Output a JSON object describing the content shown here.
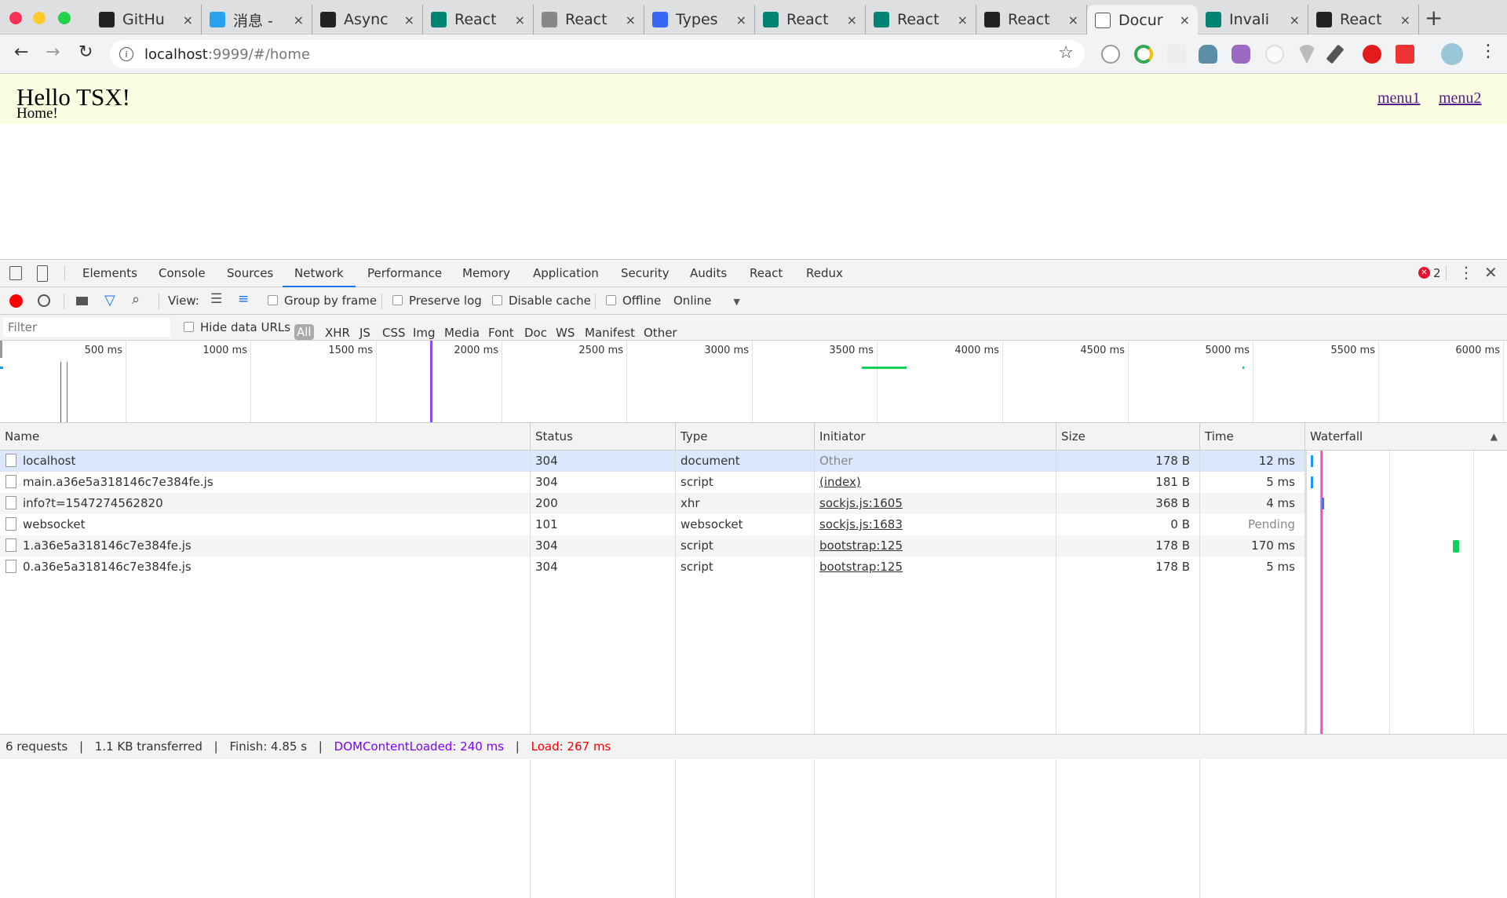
{
  "browser": {
    "tabs": [
      {
        "title": "GitHu",
        "icon": "github-icon",
        "color": "#222"
      },
      {
        "title": "消息 -",
        "icon": "cloud-icon",
        "color": "#2aa2f0"
      },
      {
        "title": "Async",
        "icon": "circle-x-icon",
        "color": "#222"
      },
      {
        "title": "React",
        "icon": "bing-icon",
        "color": "#008373"
      },
      {
        "title": "React",
        "icon": "hand-icon",
        "color": "#888"
      },
      {
        "title": "Types",
        "icon": "chevrons-icon",
        "color": "#3867f5"
      },
      {
        "title": "React",
        "icon": "bing-icon",
        "color": "#008373"
      },
      {
        "title": "React",
        "icon": "bing-icon",
        "color": "#008373"
      },
      {
        "title": "React",
        "icon": "react-icon",
        "color": "#222"
      },
      {
        "title": "Docur",
        "icon": "document-icon",
        "color": "#fff",
        "active": true
      },
      {
        "title": "Invali",
        "icon": "bing-icon",
        "color": "#008373"
      },
      {
        "title": "React",
        "icon": "github-icon",
        "color": "#222"
      }
    ],
    "url_host": "localhost",
    "url_rest": ":9999/#/home"
  },
  "page": {
    "title": "Hello TSX!",
    "subtitle": "Home!",
    "links": [
      "menu1",
      "menu2"
    ]
  },
  "devtools": {
    "tabs": [
      "Elements",
      "Console",
      "Sources",
      "Network",
      "Performance",
      "Memory",
      "Application",
      "Security",
      "Audits",
      "React",
      "Redux"
    ],
    "active_tab": "Network",
    "error_count": "2",
    "toolbar": {
      "view_label": "View:",
      "group_by_frame": "Group by frame",
      "preserve_log": "Preserve log",
      "disable_cache": "Disable cache",
      "offline": "Offline",
      "throttle": "Online"
    },
    "filter": {
      "placeholder": "Filter",
      "hide_data_urls": "Hide data URLs",
      "types": [
        "All",
        "XHR",
        "JS",
        "CSS",
        "Img",
        "Media",
        "Font",
        "Doc",
        "WS",
        "Manifest",
        "Other"
      ]
    },
    "overview": {
      "ticks": [
        "500 ms",
        "1000 ms",
        "1500 ms",
        "2000 ms",
        "2500 ms",
        "3000 ms",
        "3500 ms",
        "4000 ms",
        "4500 ms",
        "5000 ms",
        "5500 ms",
        "6000 ms"
      ],
      "dom_content_loaded_ms": 240,
      "load_ms": 267,
      "dcl_color": "#8a2be2",
      "load_color": "#ff3b30"
    },
    "columns": [
      "Name",
      "Status",
      "Type",
      "Initiator",
      "Size",
      "Time",
      "Waterfall"
    ],
    "rows": [
      {
        "name": "localhost",
        "status": "304",
        "type": "document",
        "initiator": "Other",
        "size": "178 B",
        "time": "12 ms"
      },
      {
        "name": "main.a36e5a318146c7e384fe.js",
        "status": "304",
        "type": "script",
        "initiator": "(index)",
        "size": "181 B",
        "time": "5 ms"
      },
      {
        "name": "info?t=1547274562820",
        "status": "200",
        "type": "xhr",
        "initiator": "sockjs.js:1605",
        "size": "368 B",
        "time": "4 ms"
      },
      {
        "name": "websocket",
        "status": "101",
        "type": "websocket",
        "initiator": "sockjs.js:1683",
        "size": "0 B",
        "time": "Pending"
      },
      {
        "name": "1.a36e5a318146c7e384fe.js",
        "status": "304",
        "type": "script",
        "initiator": "bootstrap:125",
        "size": "178 B",
        "time": "170 ms"
      },
      {
        "name": "0.a36e5a318146c7e384fe.js",
        "status": "304",
        "type": "script",
        "initiator": "bootstrap:125",
        "size": "178 B",
        "time": "5 ms"
      }
    ],
    "status": {
      "requests": "6 requests",
      "transferred": "1.1 KB transferred",
      "finish": "Finish: 4.85 s",
      "dcl": "DOMContentLoaded: 240 ms",
      "load": "Load: 267 ms"
    }
  }
}
